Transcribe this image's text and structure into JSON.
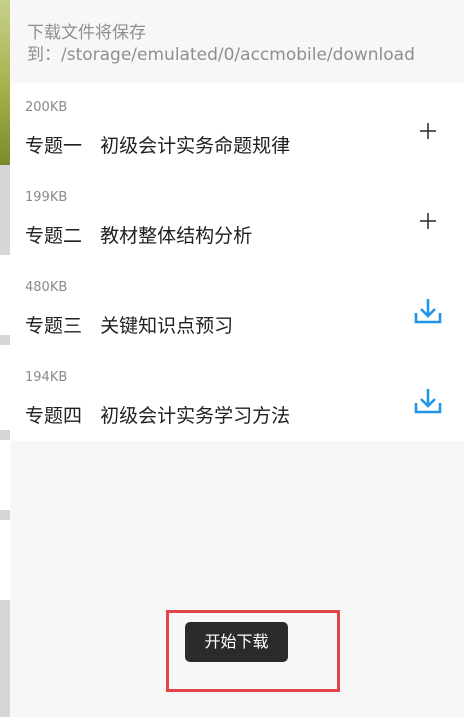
{
  "header": {
    "path_text": "下载文件将保存到：/storage/emulated/0/accmobile/download"
  },
  "files": [
    {
      "size": "200KB",
      "title": "专题一   初级会计实务命题规律",
      "action_icon": "plus-icon",
      "downloaded": false
    },
    {
      "size": "199KB",
      "title": "专题二   教材整体结构分析",
      "action_icon": "plus-icon",
      "downloaded": false
    },
    {
      "size": "480KB",
      "title": "专题三   关键知识点预习",
      "action_icon": "download-icon",
      "downloaded": true
    },
    {
      "size": "194KB",
      "title": "专题四   初级会计实务学习方法",
      "action_icon": "download-icon",
      "downloaded": true
    }
  ],
  "toast": {
    "label": "开始下载"
  },
  "colors": {
    "accent": "#2196e8",
    "highlight": "#e3454b",
    "toast_bg": "#2b2b2b"
  }
}
